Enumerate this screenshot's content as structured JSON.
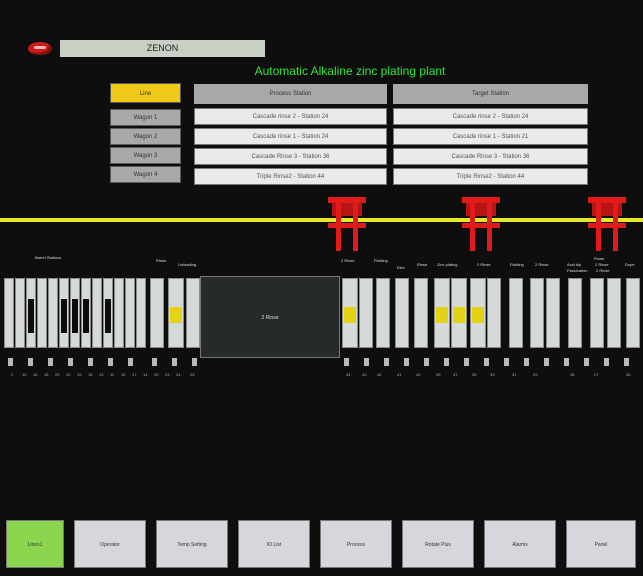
{
  "header": {
    "brand": "ZENON",
    "title": "Automatic Alkaline zinc plating plant"
  },
  "wagon_buttons": [
    "Line",
    "Wagon 1",
    "Wagon 2",
    "Wagon 3",
    "Wagon 4"
  ],
  "columns": {
    "process": "Process Station",
    "target": "Target Station"
  },
  "rows": [
    {
      "process": "Cascade rinse 2 - Station 24",
      "target": "Cascade rinse 2 - Station 24"
    },
    {
      "process": "Cascade rinse 1 - Station 24",
      "target": "Cascade rinse 1 - Station 21"
    },
    {
      "process": "Cascade Rinse 3 - Station 36",
      "target": "Cascade Rinse 3 - Station 36"
    },
    {
      "process": "Triple Rinse2 - Station 44",
      "target": "Triple Rinse2 - Station 44"
    }
  ],
  "plant": {
    "group_labels": [
      "Barrel Stations",
      "Rinse",
      "Unloading",
      "2 Rinse",
      "Pickling",
      "Elec",
      "Rinse",
      "Zinc plating",
      "2 Rinse",
      "Rinse",
      "Pickling",
      "2 Rinse",
      "Acid dip",
      "Passivation",
      "2 Rinse",
      "2 Rinse",
      "Dryer"
    ],
    "big_tank": "2 Rinse",
    "numbers": [
      "2",
      "10",
      "16",
      "18",
      "20",
      "22",
      "19",
      "15",
      "13",
      "11",
      "12",
      "17",
      "14",
      "20",
      "23",
      "24",
      "25",
      "44",
      "43",
      "42",
      "41",
      "40",
      "39",
      "37",
      "35",
      "33",
      "31",
      "29",
      "28",
      "27",
      "26"
    ]
  },
  "nav": [
    "Lines1",
    "Operator",
    "Temp Setting",
    "IO List",
    "Process",
    "Rotate Plus",
    "Alarms",
    "Panel"
  ],
  "colors": {
    "accent": "#2ee83a",
    "rail": "#e6e62a",
    "hoist": "#e11b1b",
    "active": "#f0c919",
    "nav_active": "#8bd64e"
  }
}
